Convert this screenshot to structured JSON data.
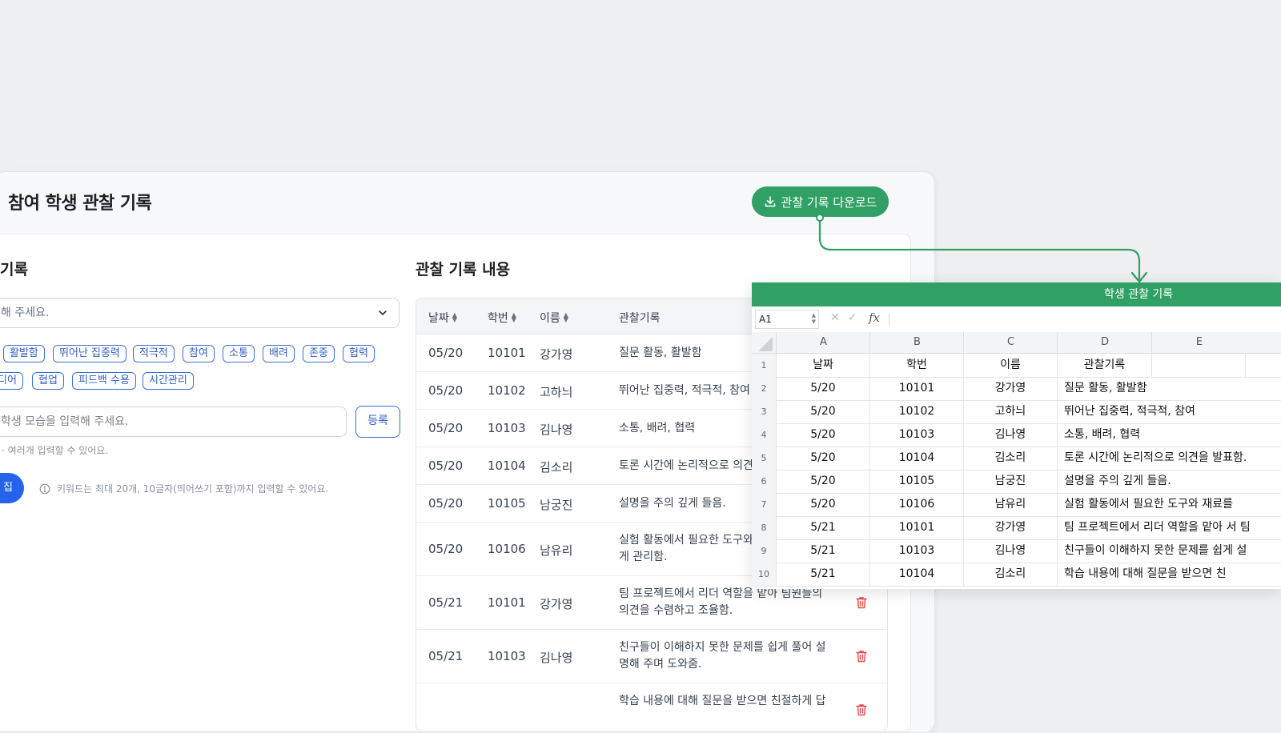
{
  "page_title": "참여 학생 관찰 기록",
  "download_button": "관찰 기록 다운로드",
  "left_panel": {
    "title": "기록",
    "select_placeholder": "해 주세요.",
    "keywords": [
      "활발함",
      "뛰어난 집중력",
      "적극적",
      "참여",
      "소통",
      "배려",
      "존중",
      "협력",
      "디어",
      "협업",
      "피드백 수용",
      "시간관리"
    ],
    "input_placeholder": "학생 모습을 입력해 주세요.",
    "register_label": "등록",
    "hint": "· 여러개 입력할 수 있어요.",
    "edit_label": "집",
    "info": "키워드는 최대 20개, 10글자(띄어쓰기 포함)까지 입력할 수 있어요."
  },
  "table": {
    "title": "관찰 기록 내용",
    "headers": [
      "날짜",
      "학번",
      "이름",
      "관찰기록"
    ],
    "rows": [
      {
        "date": "05/20",
        "id": "10101",
        "name": "강가영",
        "obs1": "질문 활동, 활발함",
        "obs2": ""
      },
      {
        "date": "05/20",
        "id": "10102",
        "name": "고하늬",
        "obs1": "뛰어난 집중력, 적극적, 참여",
        "obs2": ""
      },
      {
        "date": "05/20",
        "id": "10103",
        "name": "김나영",
        "obs1": "소통, 배려, 협력",
        "obs2": ""
      },
      {
        "date": "05/20",
        "id": "10104",
        "name": "김소리",
        "obs1": "토론 시간에 논리적으로 의견",
        "obs2": ""
      },
      {
        "date": "05/20",
        "id": "10105",
        "name": "남궁진",
        "obs1": "설명을 주의 깊게 들음.",
        "obs2": ""
      },
      {
        "date": "05/20",
        "id": "10106",
        "name": "남유리",
        "obs1": "실험 활동에서 필요한 도구와",
        "obs2": "게 관리함."
      },
      {
        "date": "05/21",
        "id": "10101",
        "name": "강가영",
        "obs1": "팀 프로젝트에서 리더 역할을 맡아 팀원들의",
        "obs2": "의견을 수렴하고 조율함."
      },
      {
        "date": "05/21",
        "id": "10103",
        "name": "김나영",
        "obs1": "친구들이 이해하지 못한 문제를 쉽게 풀어 설",
        "obs2": "명해 주며 도와줌."
      },
      {
        "date": "",
        "id": "",
        "name": "",
        "obs1": "학습 내용에 대해 질문을 받으면 친절하게 답",
        "obs2": ""
      }
    ]
  },
  "sheet": {
    "title": "학생 관찰 기록",
    "namebox": "A1",
    "columns": [
      "A",
      "B",
      "C",
      "D",
      "E"
    ],
    "rows": [
      {
        "n": "1",
        "a": "날짜",
        "b": "학번",
        "c": "이름",
        "d": "관찰기록"
      },
      {
        "n": "2",
        "a": "5/20",
        "b": "10101",
        "c": "강가영",
        "d": "질문 활동,  활발함"
      },
      {
        "n": "3",
        "a": "5/20",
        "b": "10102",
        "c": "고하늬",
        "d": "뛰어난 집중력, 적극적, 참여"
      },
      {
        "n": "4",
        "a": "5/20",
        "b": "10103",
        "c": "김나영",
        "d": "소통, 배려, 협력"
      },
      {
        "n": "5",
        "a": "5/20",
        "b": "10104",
        "c": "김소리",
        "d": "토론 시간에 논리적으로 의견을 발표함."
      },
      {
        "n": "6",
        "a": "5/20",
        "b": "10105",
        "c": "남궁진",
        "d": "설명을 주의 깊게 들음."
      },
      {
        "n": "7",
        "a": "5/20",
        "b": "10106",
        "c": "남유리",
        "d": "실험 활동에서 필요한 도구와 재료를"
      },
      {
        "n": "8",
        "a": "5/21",
        "b": "10101",
        "c": "강가영",
        "d": "팀 프로젝트에서 리더 역할을 맡아 서 팀"
      },
      {
        "n": "9",
        "a": "5/21",
        "b": "10103",
        "c": "김나영",
        "d": "친구들이 이해하지 못한 문제를 쉽게 설"
      },
      {
        "n": "10",
        "a": "5/21",
        "b": "10104",
        "c": "김소리",
        "d": "학습 내용에 대해  질문을 받으면 친"
      }
    ]
  },
  "colors": {
    "accent_green": "#30a064",
    "accent_blue": "#2563eb",
    "delete_red": "#e54848"
  }
}
